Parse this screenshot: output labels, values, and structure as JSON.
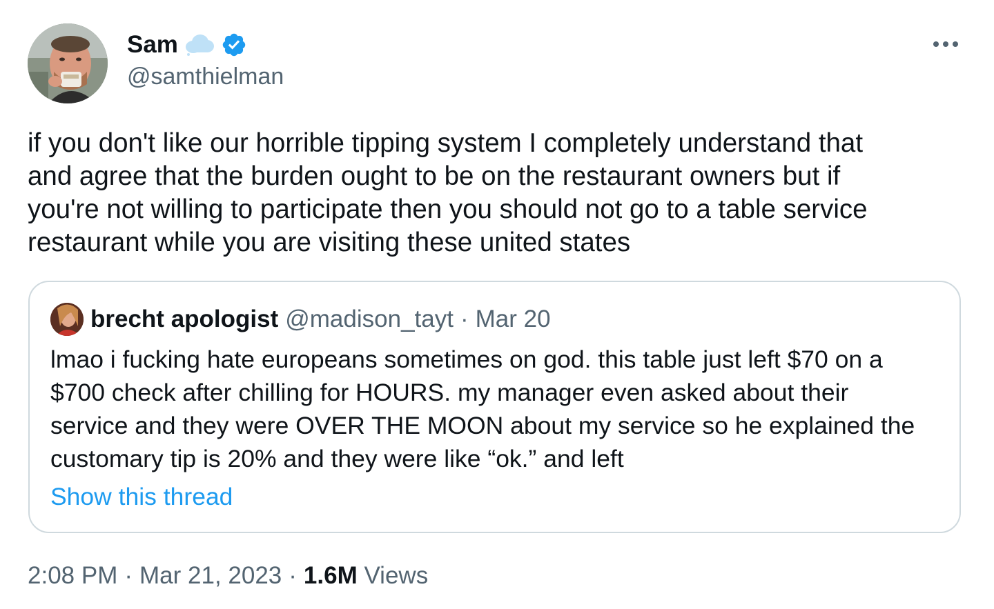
{
  "author": {
    "display_name": "Sam",
    "handle": "@samthielman",
    "avatar_icon": "profile-photo-avatar",
    "cloud_icon": "cloud-emoji-icon",
    "verified_icon": "verified-badge-icon",
    "verified_color": "#1d9bf0"
  },
  "more_icon": "more-dots-icon",
  "tweet": {
    "text": "if you don't like our horrible tipping system I completely understand that\nand agree that the burden ought to be on the restaurant owners but if\nyou're not willing to participate then you should not go to a table service\nrestaurant while you are visiting these united states"
  },
  "quote": {
    "display_name": "brecht apologist",
    "handle": "@madison_tayt",
    "separator": "·",
    "date": "Mar 20",
    "text": "lmao i fucking hate europeans sometimes on god. this table just left $70 on a\n$700 check after chilling for HOURS. my manager even asked about their\nservice and they were OVER THE MOON about my service so he explained the\ncustomary tip is 20% and they were like “ok.” and left",
    "show_thread": "Show this thread",
    "link_color": "#1d9bf0"
  },
  "meta": {
    "time": "2:08 PM",
    "sep1": "·",
    "date": "Mar 21, 2023",
    "sep2": "·",
    "views_count": "1.6M",
    "views_label": "Views"
  }
}
